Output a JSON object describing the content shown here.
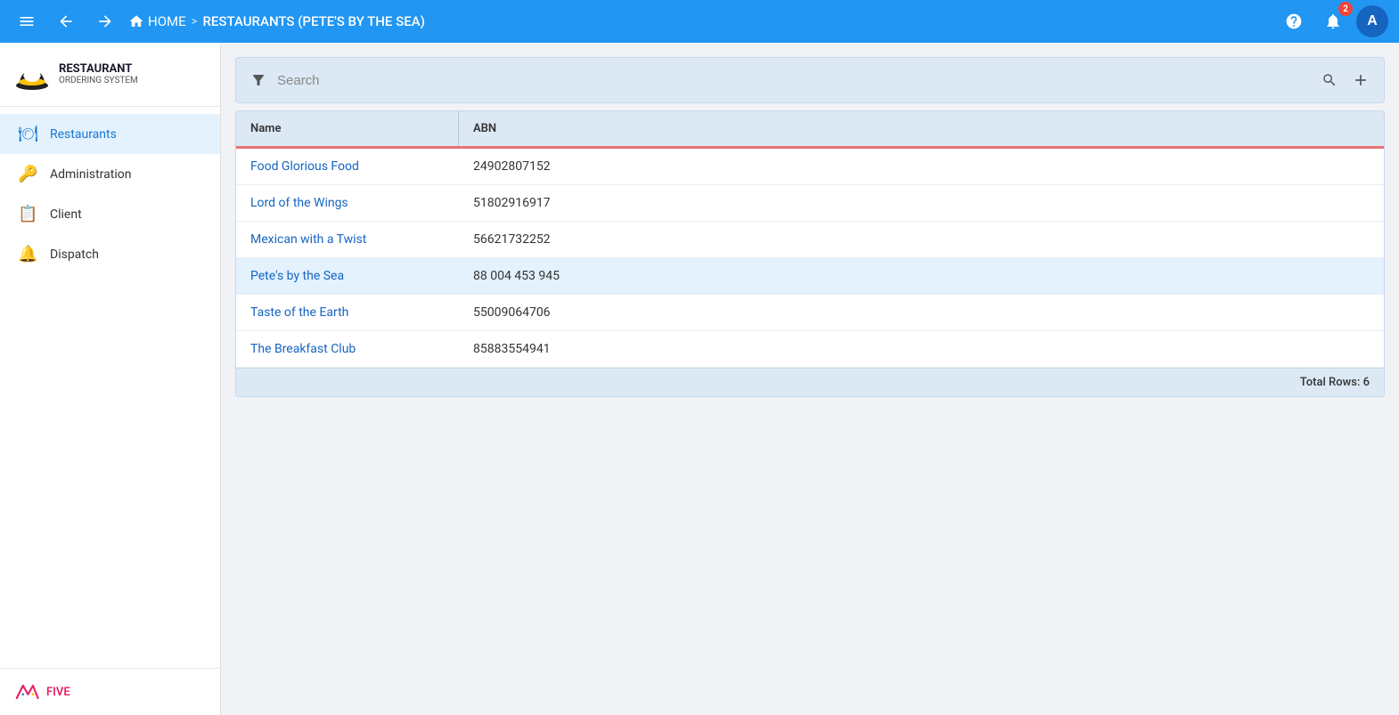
{
  "topbar": {
    "home_label": "HOME",
    "breadcrumb_separator": ">",
    "current_page": "RESTAURANTS (PETE'S BY THE SEA)",
    "notification_count": "2",
    "avatar_letter": "A"
  },
  "sidebar": {
    "logo_restaurant": "RESTAURANT",
    "logo_ordering": "ORDERING SYSTEM",
    "nav_items": [
      {
        "id": "restaurants",
        "label": "Restaurants",
        "active": true
      },
      {
        "id": "administration",
        "label": "Administration",
        "active": false
      },
      {
        "id": "client",
        "label": "Client",
        "active": false
      },
      {
        "id": "dispatch",
        "label": "Dispatch",
        "active": false
      }
    ],
    "footer_brand": "FIVE"
  },
  "search": {
    "placeholder": "Search"
  },
  "table": {
    "columns": [
      {
        "id": "name",
        "label": "Name"
      },
      {
        "id": "abn",
        "label": "ABN"
      }
    ],
    "rows": [
      {
        "name": "Food Glorious Food",
        "abn": "24902807152",
        "selected": false
      },
      {
        "name": "Lord of the Wings",
        "abn": "51802916917",
        "selected": false
      },
      {
        "name": "Mexican with a Twist",
        "abn": "56621732252",
        "selected": false
      },
      {
        "name": "Pete's by the Sea",
        "abn": "88 004 453 945",
        "selected": true
      },
      {
        "name": "Taste of the Earth",
        "abn": "55009064706",
        "selected": false
      },
      {
        "name": "The Breakfast Club",
        "abn": "85883554941",
        "selected": false
      }
    ],
    "footer": "Total Rows: 6"
  }
}
